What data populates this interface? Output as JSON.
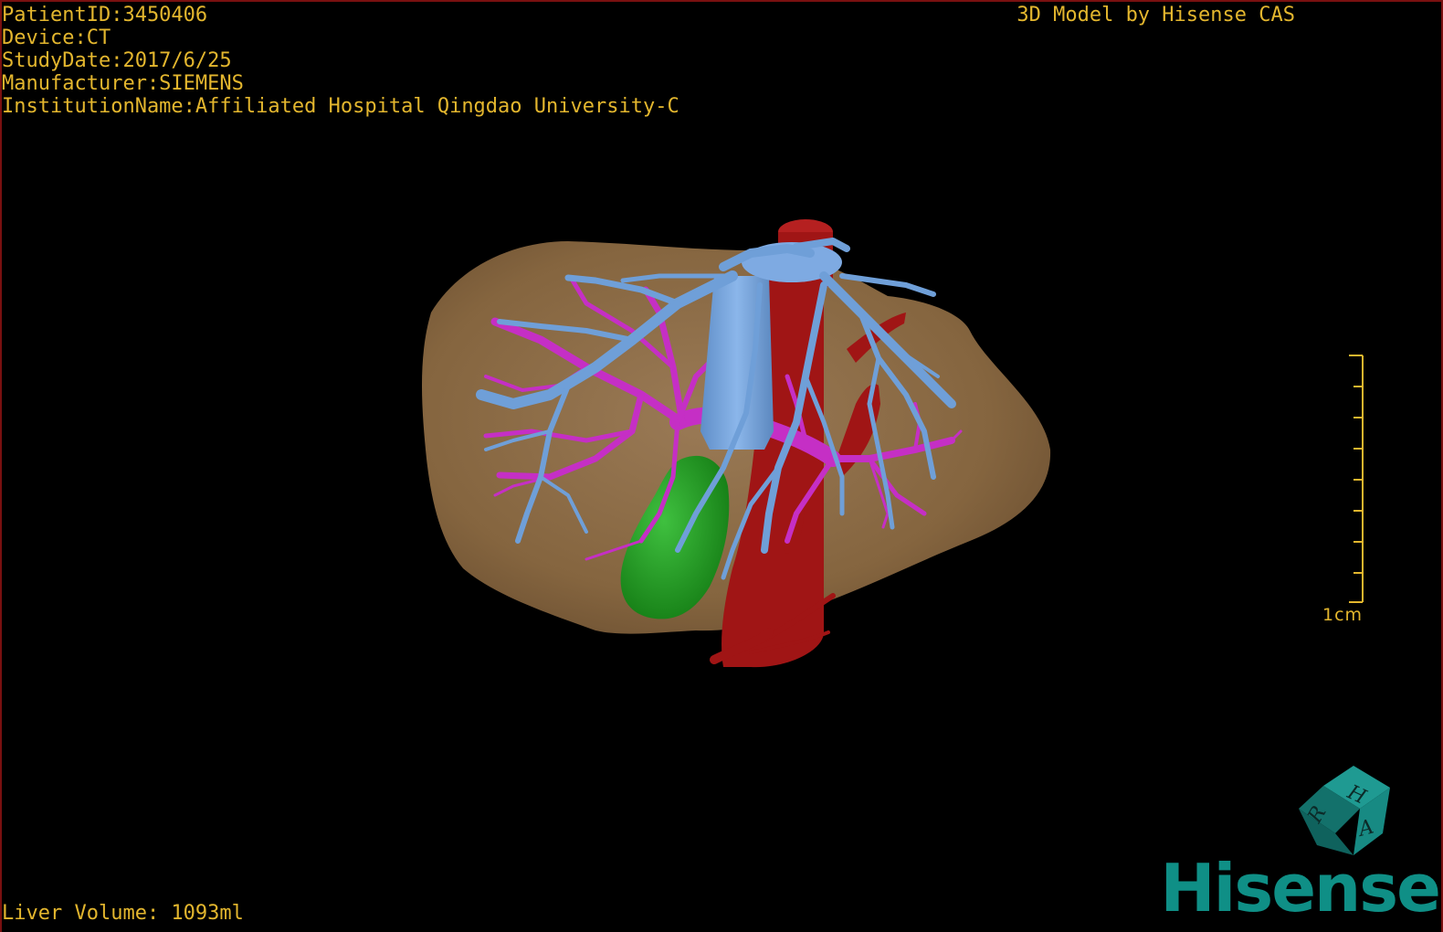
{
  "study_info": {
    "patient_id": "PatientID:3450406",
    "device": "Device:CT",
    "study_date": "StudyDate:2017/6/25",
    "manufacturer": "Manufacturer:SIEMENS",
    "institution": "InstitutionName:Affiliated Hospital Qingdao University-C"
  },
  "model_credit": "3D Model by Hisense CAS",
  "liver_volume": "Liver Volume: 1093ml",
  "scale_bar": {
    "label": "1cm"
  },
  "orientation_cube": {
    "faces": [
      "H",
      "R",
      "A"
    ],
    "color": "#17807a"
  },
  "brand": {
    "name": "Hisense",
    "color": "#0f8f86"
  },
  "colors": {
    "background": "#000000",
    "overlay_text": "#e3b62e",
    "liver": "#8a6a48",
    "hepatic_vein": "#6f9fd8",
    "portal_vein": "#c52fc5",
    "artery_ivc": "#a01515",
    "gallbladder": "#1f9a1f"
  }
}
